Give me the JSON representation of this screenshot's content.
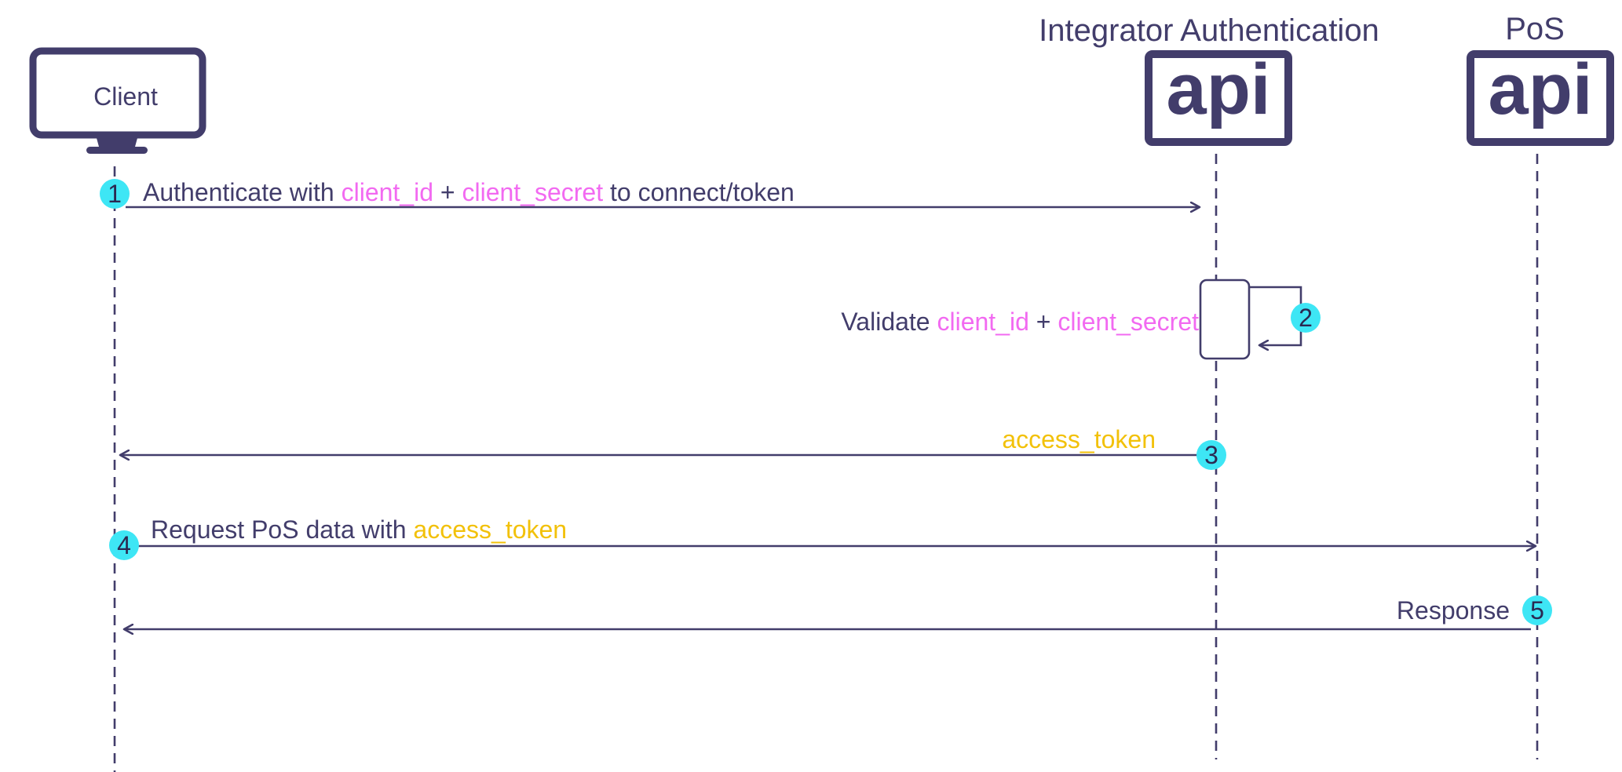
{
  "colors": {
    "primary": "#423D6B",
    "highlight_pink": "#F26AF1",
    "highlight_yellow": "#F2C10A",
    "badge": "#3EE6F5"
  },
  "participants": {
    "client": {
      "label": "Client",
      "icon": "monitor-icon"
    },
    "auth": {
      "title": "Integrator Authentication",
      "icon_text": "api",
      "icon": "api-icon"
    },
    "pos": {
      "title": "PoS",
      "icon_text": "api",
      "icon": "api-icon"
    }
  },
  "steps": [
    {
      "number": "1",
      "parts": [
        "Authenticate with ",
        "client_id",
        " + ",
        "client_secret",
        " to connect/token"
      ]
    },
    {
      "number": "2",
      "parts": [
        "Validate ",
        "client_id",
        " + ",
        "client_secret"
      ]
    },
    {
      "number": "3",
      "parts": [
        "access_token"
      ]
    },
    {
      "number": "4",
      "parts": [
        "Request PoS data with ",
        "access_token"
      ]
    },
    {
      "number": "5",
      "parts": [
        "Response"
      ]
    }
  ]
}
